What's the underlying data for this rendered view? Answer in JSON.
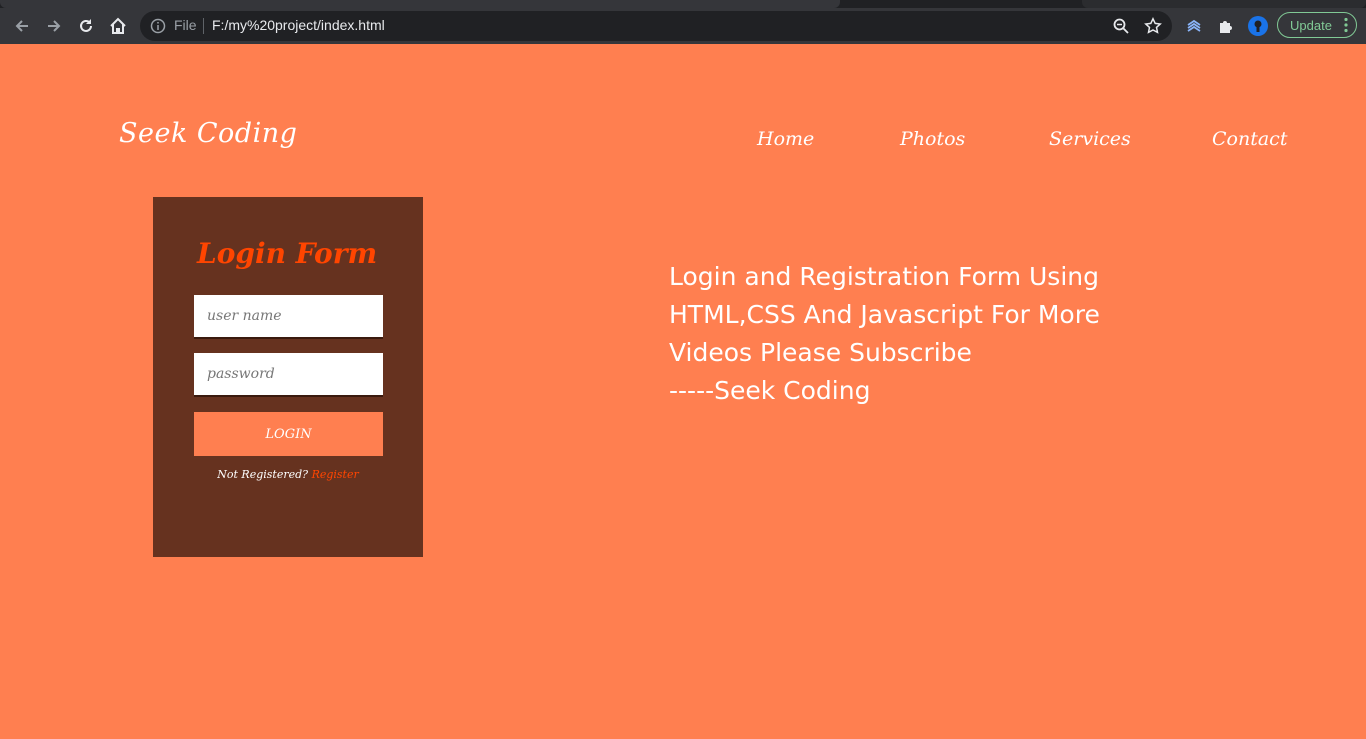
{
  "browser": {
    "file_label": "File",
    "url": "F:/my%20project/index.html",
    "update_label": "Update",
    "icons": [
      "back-arrow-icon",
      "forward-arrow-icon",
      "reload-icon",
      "home-icon",
      "info-icon",
      "zoom-icon",
      "star-icon",
      "extension-layers-icon",
      "puzzle-icon",
      "profile-avatar-icon",
      "more-vertical-icon"
    ],
    "colors": {
      "toolbar": "#35363a",
      "omnibox": "#202124",
      "update_accent": "#81c995"
    }
  },
  "header": {
    "logo": "Seek Coding",
    "nav": [
      "Home",
      "Photos",
      "Services",
      "Contact"
    ]
  },
  "login_form": {
    "title": "Login Form",
    "username_placeholder": "user name",
    "password_placeholder": "password",
    "button_label": "LOGIN",
    "not_registered": "Not Registered?",
    "register_link": "Register"
  },
  "promo": {
    "lines": [
      "Login and Registration Form Using",
      "HTML,CSS And Javascript For More",
      "Videos Please Subscribe",
      "-----Seek Coding"
    ]
  },
  "colors": {
    "page_background": "#ff7f50",
    "form_background": "#66321f",
    "accent": "#ff4500",
    "text": "#ffffff"
  }
}
